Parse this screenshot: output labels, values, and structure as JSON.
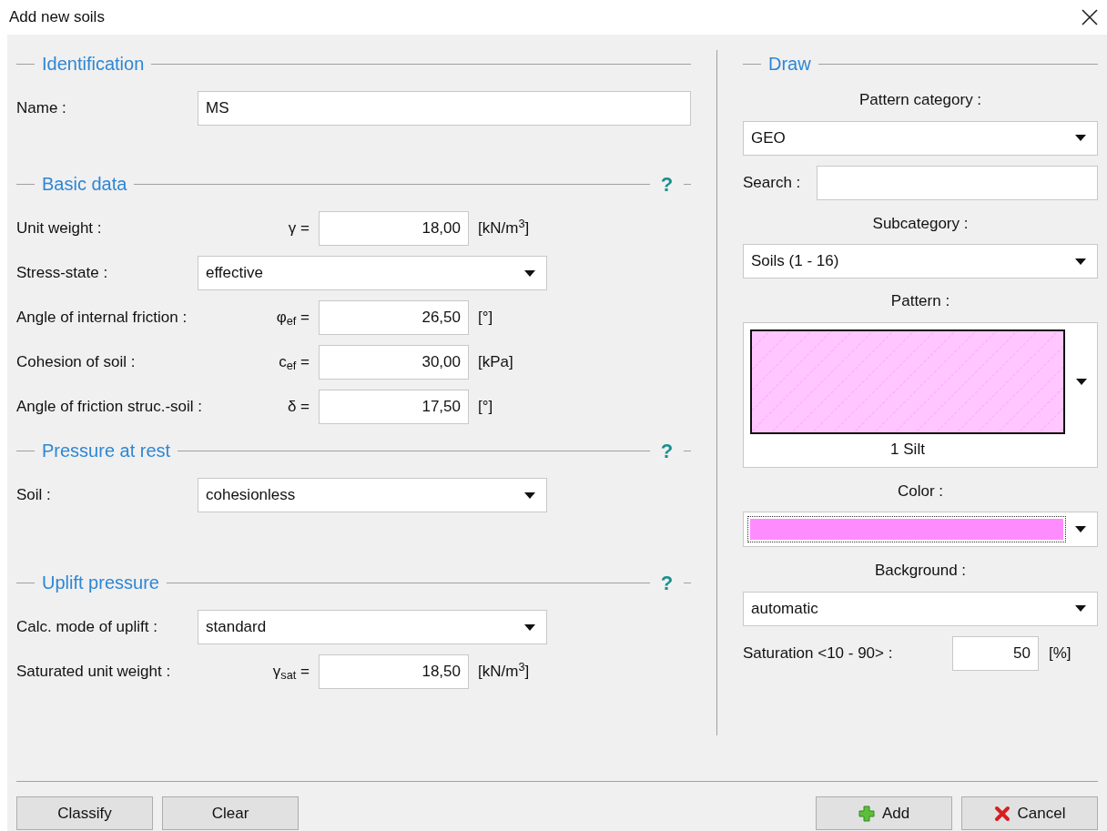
{
  "window": {
    "title": "Add new soils"
  },
  "sections": [
    {
      "title": "Identification",
      "rows": [
        {
          "kind": "text",
          "label": "Name :",
          "value": "MS"
        }
      ]
    },
    {
      "title": "Basic data",
      "help": "?",
      "rows": [
        {
          "kind": "number",
          "label": "Unit weight :",
          "symbol": "γ =",
          "value": "18,00",
          "unit": "[kN/m$^{3}$]"
        },
        {
          "kind": "select",
          "label": "Stress-state :",
          "value": "effective"
        },
        {
          "kind": "number",
          "label": "Angle of internal friction :",
          "symbol": "φ$_{ef}$ =",
          "value": "26,50",
          "unit": "[°]"
        },
        {
          "kind": "number",
          "label": "Cohesion of soil :",
          "symbol": "c$_{ef}$ =",
          "value": "30,00",
          "unit": "[kPa]"
        },
        {
          "kind": "number",
          "label": "Angle of friction struc.-soil :",
          "symbol": "δ =",
          "value": "17,50",
          "unit": "[°]"
        }
      ]
    },
    {
      "title": "Pressure at rest",
      "help": "?",
      "rows": [
        {
          "kind": "select",
          "label": "Soil :",
          "value": "cohesionless"
        }
      ]
    },
    {
      "title": "Uplift pressure",
      "help": "?",
      "rows": [
        {
          "kind": "select",
          "label": "Calc. mode of uplift :",
          "value": "standard"
        },
        {
          "kind": "number",
          "label": "Saturated unit weight :",
          "symbol": "γ$_{sat}$ =",
          "value": "18,50",
          "unit": "[kN/m$^{3}$]"
        }
      ]
    }
  ],
  "draw": {
    "title": "Draw",
    "pattern_category": {
      "label": "Pattern category :",
      "value": "GEO"
    },
    "search": {
      "label": "Search :"
    },
    "subcategory": {
      "label": "Subcategory :",
      "value": "Soils (1 - 16)"
    },
    "pattern": {
      "label": "Pattern :",
      "name": "1 Silt"
    },
    "color": {
      "label": "Color :",
      "color": "#ff8cff"
    },
    "background": {
      "label": "Background :",
      "value": "automatic"
    },
    "saturation": {
      "label": "Saturation <10 - 90> :",
      "value": "50",
      "unit": "[%]"
    }
  },
  "buttons_left": [
    {
      "label": "Classify"
    },
    {
      "label": "Clear"
    }
  ],
  "buttons_right": [
    {
      "label": "Add",
      "kind": "add"
    },
    {
      "label": "Cancel",
      "kind": "cancel"
    }
  ]
}
